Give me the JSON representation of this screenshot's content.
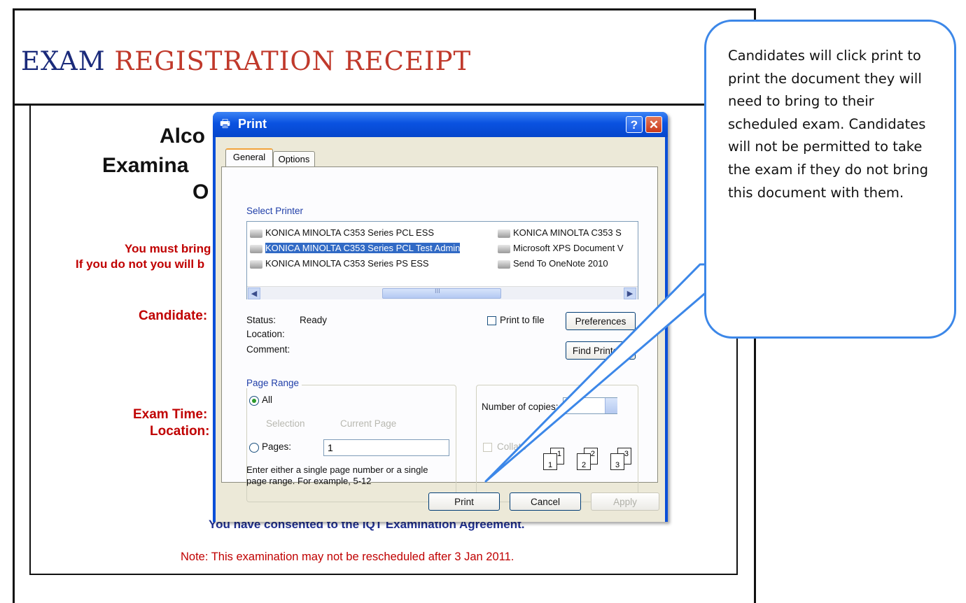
{
  "receipt": {
    "title_word1": "EXAM",
    "title_rest": " REGISTRATION RECEIPT",
    "heading_line1": "Alco",
    "heading_line2": "Examina",
    "heading_line3": "O",
    "bring_line1": "You must bring",
    "bring_line2": "If you do not you will b",
    "candidate_label": "Candidate:",
    "exam_time_label": "Exam Time:",
    "location_label": "Location:",
    "consent_text": "You have consented to the IQT Examination Agreement.",
    "note_text": "Note: This examination may not be rescheduled after 3 Jan 2011."
  },
  "print_dialog": {
    "title": "Print",
    "help_label": "?",
    "close_label": "✕",
    "tabs": [
      {
        "label": "General"
      },
      {
        "label": "Options"
      }
    ],
    "select_printer_label": "Select Printer",
    "printers": [
      {
        "name": "KONICA MINOLTA C353 Series PCL ESS"
      },
      {
        "name": "KONICA MINOLTA C353 S"
      },
      {
        "name": "KONICA MINOLTA C353 Series PCL Test Admin"
      },
      {
        "name": "Microsoft XPS Document V"
      },
      {
        "name": "KONICA MINOLTA C353 Series PS ESS"
      },
      {
        "name": "Send To OneNote 2010"
      }
    ],
    "scroll_thumb_label": "III",
    "status_label": "Status:",
    "status_value": "Ready",
    "location_label": "Location:",
    "comment_label": "Comment:",
    "print_to_file_label": "Print to file",
    "preferences_label": "Preferences",
    "find_printer_label": "Find Printer...",
    "page_range_label": "Page Range",
    "all_label": "All",
    "selection_label": "Selection",
    "current_page_label": "Current Page",
    "pages_label": "Pages:",
    "pages_value": "1",
    "range_hint_line1": "Enter either a single page number or a single",
    "range_hint_line2": "page range.  For example, 5-12",
    "copies_label": "Number of copies:",
    "collate_label": "Collate",
    "collate_pages": [
      "1",
      "1",
      "2",
      "2",
      "3",
      "3"
    ],
    "print_button": "Print",
    "cancel_button": "Cancel",
    "apply_button": "Apply"
  },
  "callout": {
    "text": "Candidates will click print to print the document they will need to bring to their scheduled exam. Candidates will not be permitted to take the exam if they do not bring this document with them."
  }
}
